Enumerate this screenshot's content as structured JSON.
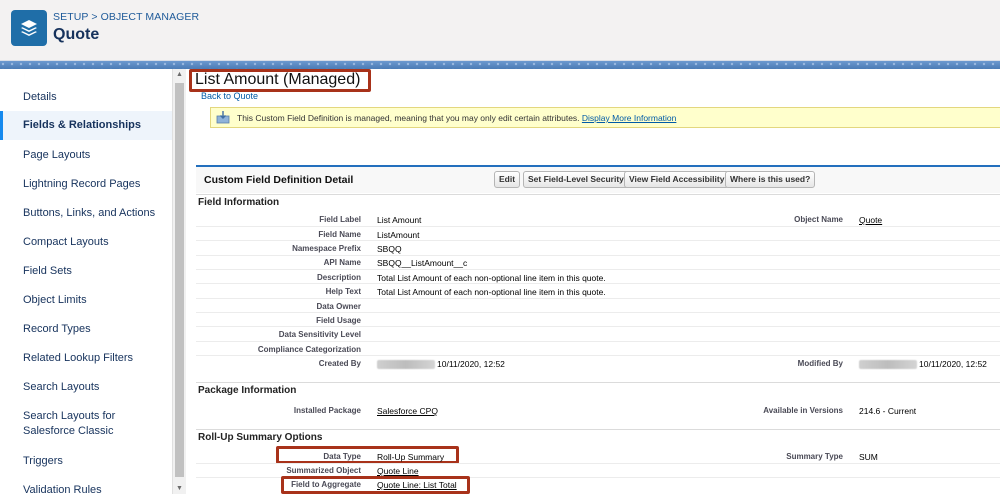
{
  "header": {
    "breadcrumb": "SETUP > OBJECT MANAGER",
    "title": "Quote",
    "icon": "layers-icon"
  },
  "sidebar": {
    "items": [
      {
        "label": "Details"
      },
      {
        "label": "Fields & Relationships",
        "active": true
      },
      {
        "label": "Page Layouts"
      },
      {
        "label": "Lightning Record Pages"
      },
      {
        "label": "Buttons, Links, and Actions"
      },
      {
        "label": "Compact Layouts"
      },
      {
        "label": "Field Sets"
      },
      {
        "label": "Object Limits"
      },
      {
        "label": "Record Types"
      },
      {
        "label": "Related Lookup Filters"
      },
      {
        "label": "Search Layouts"
      },
      {
        "label": "Search Layouts for",
        "label2": "Salesforce Classic"
      },
      {
        "label": "Triggers"
      },
      {
        "label": "Validation Rules"
      }
    ]
  },
  "main": {
    "field_title": "List Amount (Managed)",
    "back_link": "Back to Quote",
    "banner": {
      "text": "This Custom Field Definition is managed, meaning that you may only edit certain attributes.",
      "link": "Display More Information"
    },
    "detail": {
      "title": "Custom Field Definition Detail",
      "buttons": [
        "Edit",
        "Set Field-Level Security",
        "View Field Accessibility",
        "Where is this used?"
      ]
    },
    "field_information": {
      "heading": "Field Information",
      "rows": [
        {
          "label": "Field Label",
          "value": "List Amount"
        },
        {
          "label": "Field Name",
          "value": "ListAmount"
        },
        {
          "label": "Namespace Prefix",
          "value": "SBQQ"
        },
        {
          "label": "API Name",
          "value": "SBQQ__ListAmount__c"
        },
        {
          "label": "Description",
          "value": "Total List Amount of each non-optional line item in this quote."
        },
        {
          "label": "Help Text",
          "value": "Total List Amount of each non-optional line item in this quote."
        },
        {
          "label": "Data Owner",
          "value": ""
        },
        {
          "label": "Field Usage",
          "value": ""
        },
        {
          "label": "Data Sensitivity Level",
          "value": ""
        },
        {
          "label": "Compliance Categorization",
          "value": ""
        },
        {
          "label": "Created By",
          "value": "10/11/2020, 12:52"
        }
      ],
      "object_name_label": "Object Name",
      "object_name_value": "Quote",
      "modified_by_label": "Modified By",
      "modified_by_value": "10/11/2020, 12:52"
    },
    "package_information": {
      "heading": "Package Information",
      "installed_package_label": "Installed Package",
      "installed_package_value": "Salesforce CPQ",
      "available_label": "Available in Versions",
      "available_value": "214.6 - Current"
    },
    "rollup": {
      "heading": "Roll-Up Summary Options",
      "data_type_label": "Data Type",
      "data_type_value": "Roll-Up Summary",
      "summarized_object_label": "Summarized Object",
      "summarized_object_value": "Quote Line",
      "field_to_aggregate_label": "Field to Aggregate",
      "field_to_aggregate_value": "Quote Line: List Total",
      "summary_type_label": "Summary Type",
      "summary_type_value": "SUM"
    }
  },
  "colors": {
    "highlight": "#a8321a",
    "accent": "#1589ee",
    "brand_tile": "#1f6ea8",
    "banner_bg": "#ffffcc"
  }
}
